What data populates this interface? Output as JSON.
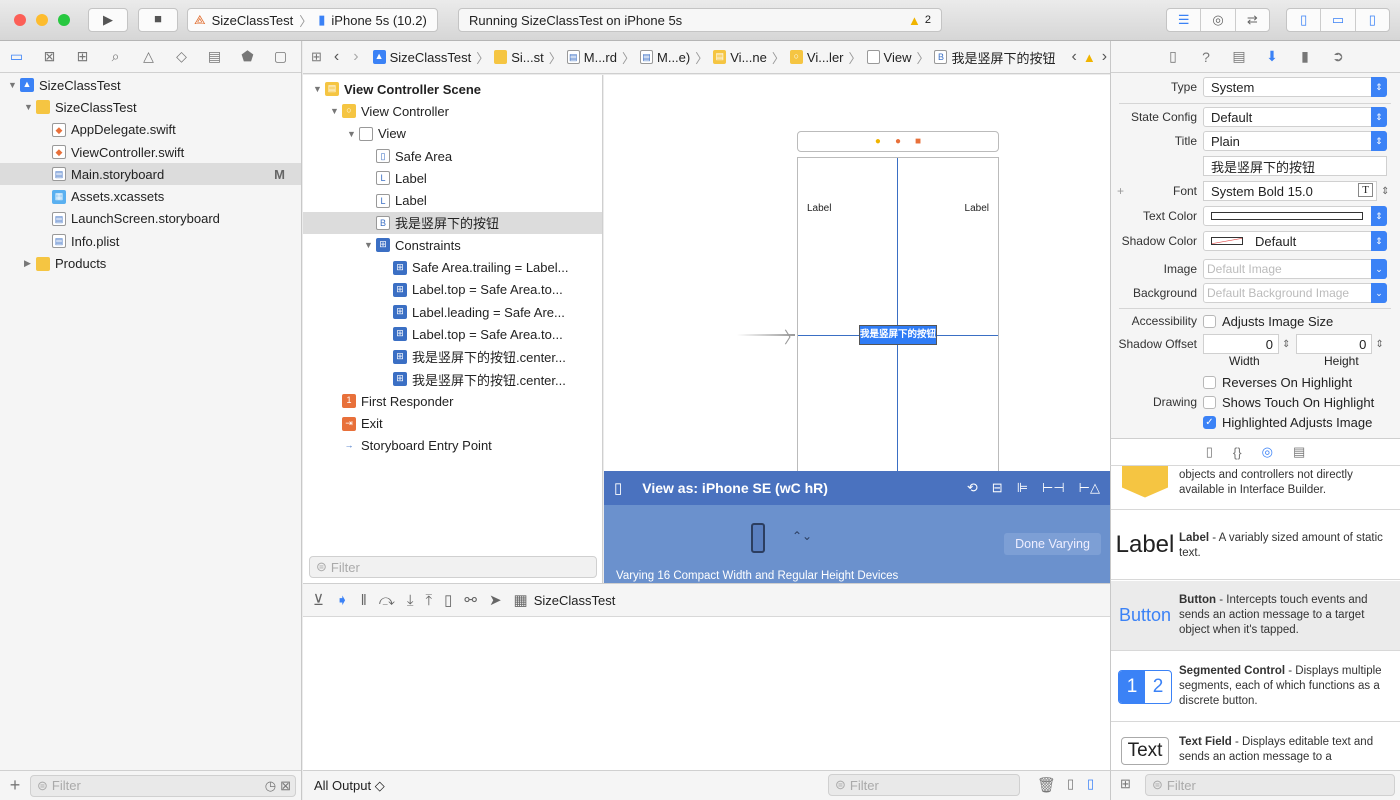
{
  "toolbar": {
    "scheme": "SizeClassTest",
    "device": "iPhone 5s (10.2)",
    "status": "Running SizeClassTest on iPhone 5s",
    "warning_count": "2"
  },
  "navigator": {
    "items": [
      {
        "label": "SizeClassTest",
        "depth": 0,
        "icon": "project",
        "expanded": true
      },
      {
        "label": "SizeClassTest",
        "depth": 1,
        "icon": "folder",
        "expanded": true
      },
      {
        "label": "AppDelegate.swift",
        "depth": 2,
        "icon": "swift"
      },
      {
        "label": "ViewController.swift",
        "depth": 2,
        "icon": "swift"
      },
      {
        "label": "Main.storyboard",
        "depth": 2,
        "icon": "storyboard",
        "badge": "M",
        "selected": true
      },
      {
        "label": "Assets.xcassets",
        "depth": 2,
        "icon": "assets"
      },
      {
        "label": "LaunchScreen.storyboard",
        "depth": 2,
        "icon": "storyboard"
      },
      {
        "label": "Info.plist",
        "depth": 2,
        "icon": "plist"
      },
      {
        "label": "Products",
        "depth": 1,
        "icon": "folder",
        "expanded": false
      }
    ],
    "filter_placeholder": "Filter"
  },
  "jumpbar": {
    "crumbs": [
      "SizeClassTest",
      "Si...st",
      "M...rd",
      "M...e)",
      "Vi...ne",
      "Vi...ler",
      "View",
      "我是竖屏下的按钮"
    ]
  },
  "outline": {
    "items": [
      {
        "label": "View Controller Scene",
        "depth": 0,
        "icon": "scene",
        "expanded": true,
        "bold": true
      },
      {
        "label": "View Controller",
        "depth": 1,
        "icon": "vc",
        "expanded": true
      },
      {
        "label": "View",
        "depth": 2,
        "icon": "view",
        "expanded": true
      },
      {
        "label": "Safe Area",
        "depth": 3,
        "icon": "safearea"
      },
      {
        "label": "Label",
        "depth": 3,
        "icon": "L"
      },
      {
        "label": "Label",
        "depth": 3,
        "icon": "L"
      },
      {
        "label": "我是竖屏下的按钮",
        "depth": 3,
        "icon": "B",
        "selected": true
      },
      {
        "label": "Constraints",
        "depth": 3,
        "icon": "constraints",
        "expanded": true
      },
      {
        "label": "Safe Area.trailing = Label...",
        "depth": 4,
        "icon": "constraint"
      },
      {
        "label": "Label.top = Safe Area.to...",
        "depth": 4,
        "icon": "constraint"
      },
      {
        "label": "Label.leading = Safe Are...",
        "depth": 4,
        "icon": "constraint"
      },
      {
        "label": "Label.top = Safe Area.to...",
        "depth": 4,
        "icon": "constraint"
      },
      {
        "label": "我是竖屏下的按钮.center...",
        "depth": 4,
        "icon": "constraint"
      },
      {
        "label": "我是竖屏下的按钮.center...",
        "depth": 4,
        "icon": "constraint"
      },
      {
        "label": "First Responder",
        "depth": 1,
        "icon": "responder"
      },
      {
        "label": "Exit",
        "depth": 1,
        "icon": "exit"
      },
      {
        "label": "Storyboard Entry Point",
        "depth": 1,
        "icon": "arrow"
      }
    ],
    "filter_placeholder": "Filter"
  },
  "canvas": {
    "label_left": "Label",
    "label_right": "Label",
    "button_title": "我是竖屏下的按钮"
  },
  "viewas": {
    "title": "View as: iPhone SE (wC hR)",
    "done_button": "Done Varying",
    "varying_text": "Varying 16 Compact Width and Regular Height Devices"
  },
  "debug": {
    "target": "SizeClassTest",
    "output_select": "All Output ◇",
    "filter_placeholder": "Filter"
  },
  "inspector": {
    "type_label": "Type",
    "type_value": "System",
    "state_label": "State Config",
    "state_value": "Default",
    "title_label": "Title",
    "title_value": "Plain",
    "title_text": "我是竖屏下的按钮",
    "font_label": "Font",
    "font_value": "System Bold 15.0",
    "text_color_label": "Text Color",
    "text_color": "#ffffff",
    "shadow_color_label": "Shadow Color",
    "shadow_color_value": "Default",
    "image_label": "Image",
    "image_placeholder": "Default Image",
    "background_label": "Background",
    "background_placeholder": "Default Background Image",
    "accessibility_label": "Accessibility",
    "adjusts_image_size": "Adjusts Image Size",
    "shadow_offset_label": "Shadow Offset",
    "shadow_width": "0",
    "shadow_height": "0",
    "width_label": "Width",
    "height_label": "Height",
    "drawing_label": "Drawing",
    "reverses": "Reverses On Highlight",
    "shows_touch": "Shows Touch On Highlight",
    "highlighted_adjusts": "Highlighted Adjusts Image",
    "highlighted_adjusts_checked": true
  },
  "library": {
    "items": [
      {
        "preview": "",
        "name": "",
        "desc": "objects and controllers not directly available in Interface Builder."
      },
      {
        "preview": "Label",
        "name": "Label",
        "desc": " - A variably sized amount of static text."
      },
      {
        "preview": "Button",
        "name": "Button",
        "desc": " - Intercepts touch events and sends an action message to a target object when it's tapped."
      },
      {
        "preview": "",
        "name": "Segmented Control",
        "desc": " - Displays multiple segments, each of which functions as a discrete button.",
        "seg1": "1",
        "seg2": "2"
      },
      {
        "preview": "Text",
        "name": "Text Field",
        "desc": " - Displays editable text and sends an action message to a"
      }
    ],
    "filter_placeholder": "Filter"
  },
  "colors": {
    "accent": "#3b82f6",
    "viewas_bar": "#4a72bf",
    "varying_panel": "#6b91cd",
    "constraint_line": "#3a6fc4"
  }
}
